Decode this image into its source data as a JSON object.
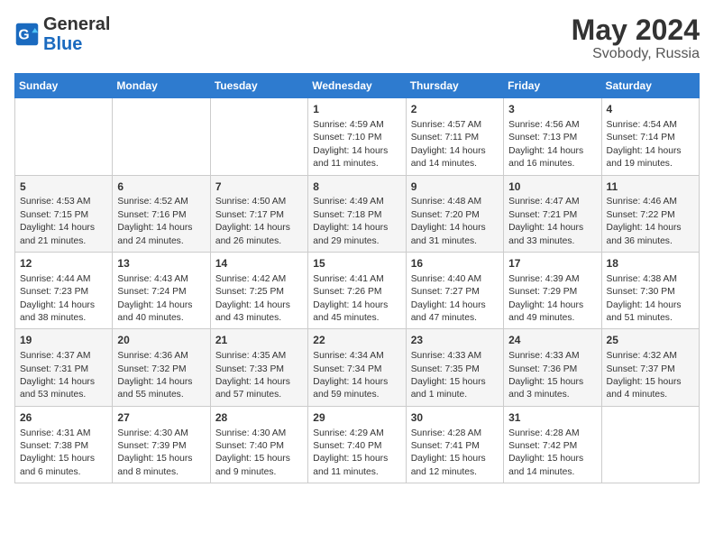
{
  "header": {
    "logo_general": "General",
    "logo_blue": "Blue",
    "month": "May 2024",
    "location": "Svobody, Russia"
  },
  "days_of_week": [
    "Sunday",
    "Monday",
    "Tuesday",
    "Wednesday",
    "Thursday",
    "Friday",
    "Saturday"
  ],
  "weeks": [
    [
      {
        "day": "",
        "info": ""
      },
      {
        "day": "",
        "info": ""
      },
      {
        "day": "",
        "info": ""
      },
      {
        "day": "1",
        "info": "Sunrise: 4:59 AM\nSunset: 7:10 PM\nDaylight: 14 hours\nand 11 minutes."
      },
      {
        "day": "2",
        "info": "Sunrise: 4:57 AM\nSunset: 7:11 PM\nDaylight: 14 hours\nand 14 minutes."
      },
      {
        "day": "3",
        "info": "Sunrise: 4:56 AM\nSunset: 7:13 PM\nDaylight: 14 hours\nand 16 minutes."
      },
      {
        "day": "4",
        "info": "Sunrise: 4:54 AM\nSunset: 7:14 PM\nDaylight: 14 hours\nand 19 minutes."
      }
    ],
    [
      {
        "day": "5",
        "info": "Sunrise: 4:53 AM\nSunset: 7:15 PM\nDaylight: 14 hours\nand 21 minutes."
      },
      {
        "day": "6",
        "info": "Sunrise: 4:52 AM\nSunset: 7:16 PM\nDaylight: 14 hours\nand 24 minutes."
      },
      {
        "day": "7",
        "info": "Sunrise: 4:50 AM\nSunset: 7:17 PM\nDaylight: 14 hours\nand 26 minutes."
      },
      {
        "day": "8",
        "info": "Sunrise: 4:49 AM\nSunset: 7:18 PM\nDaylight: 14 hours\nand 29 minutes."
      },
      {
        "day": "9",
        "info": "Sunrise: 4:48 AM\nSunset: 7:20 PM\nDaylight: 14 hours\nand 31 minutes."
      },
      {
        "day": "10",
        "info": "Sunrise: 4:47 AM\nSunset: 7:21 PM\nDaylight: 14 hours\nand 33 minutes."
      },
      {
        "day": "11",
        "info": "Sunrise: 4:46 AM\nSunset: 7:22 PM\nDaylight: 14 hours\nand 36 minutes."
      }
    ],
    [
      {
        "day": "12",
        "info": "Sunrise: 4:44 AM\nSunset: 7:23 PM\nDaylight: 14 hours\nand 38 minutes."
      },
      {
        "day": "13",
        "info": "Sunrise: 4:43 AM\nSunset: 7:24 PM\nDaylight: 14 hours\nand 40 minutes."
      },
      {
        "day": "14",
        "info": "Sunrise: 4:42 AM\nSunset: 7:25 PM\nDaylight: 14 hours\nand 43 minutes."
      },
      {
        "day": "15",
        "info": "Sunrise: 4:41 AM\nSunset: 7:26 PM\nDaylight: 14 hours\nand 45 minutes."
      },
      {
        "day": "16",
        "info": "Sunrise: 4:40 AM\nSunset: 7:27 PM\nDaylight: 14 hours\nand 47 minutes."
      },
      {
        "day": "17",
        "info": "Sunrise: 4:39 AM\nSunset: 7:29 PM\nDaylight: 14 hours\nand 49 minutes."
      },
      {
        "day": "18",
        "info": "Sunrise: 4:38 AM\nSunset: 7:30 PM\nDaylight: 14 hours\nand 51 minutes."
      }
    ],
    [
      {
        "day": "19",
        "info": "Sunrise: 4:37 AM\nSunset: 7:31 PM\nDaylight: 14 hours\nand 53 minutes."
      },
      {
        "day": "20",
        "info": "Sunrise: 4:36 AM\nSunset: 7:32 PM\nDaylight: 14 hours\nand 55 minutes."
      },
      {
        "day": "21",
        "info": "Sunrise: 4:35 AM\nSunset: 7:33 PM\nDaylight: 14 hours\nand 57 minutes."
      },
      {
        "day": "22",
        "info": "Sunrise: 4:34 AM\nSunset: 7:34 PM\nDaylight: 14 hours\nand 59 minutes."
      },
      {
        "day": "23",
        "info": "Sunrise: 4:33 AM\nSunset: 7:35 PM\nDaylight: 15 hours\nand 1 minute."
      },
      {
        "day": "24",
        "info": "Sunrise: 4:33 AM\nSunset: 7:36 PM\nDaylight: 15 hours\nand 3 minutes."
      },
      {
        "day": "25",
        "info": "Sunrise: 4:32 AM\nSunset: 7:37 PM\nDaylight: 15 hours\nand 4 minutes."
      }
    ],
    [
      {
        "day": "26",
        "info": "Sunrise: 4:31 AM\nSunset: 7:38 PM\nDaylight: 15 hours\nand 6 minutes."
      },
      {
        "day": "27",
        "info": "Sunrise: 4:30 AM\nSunset: 7:39 PM\nDaylight: 15 hours\nand 8 minutes."
      },
      {
        "day": "28",
        "info": "Sunrise: 4:30 AM\nSunset: 7:40 PM\nDaylight: 15 hours\nand 9 minutes."
      },
      {
        "day": "29",
        "info": "Sunrise: 4:29 AM\nSunset: 7:40 PM\nDaylight: 15 hours\nand 11 minutes."
      },
      {
        "day": "30",
        "info": "Sunrise: 4:28 AM\nSunset: 7:41 PM\nDaylight: 15 hours\nand 12 minutes."
      },
      {
        "day": "31",
        "info": "Sunrise: 4:28 AM\nSunset: 7:42 PM\nDaylight: 15 hours\nand 14 minutes."
      },
      {
        "day": "",
        "info": ""
      }
    ]
  ]
}
